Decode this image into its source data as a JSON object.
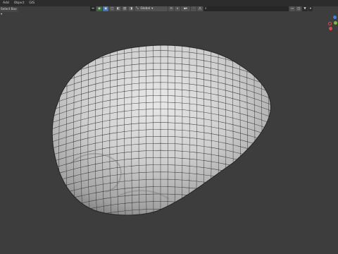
{
  "menu": {
    "items": [
      "Add",
      "Object",
      "GIS"
    ]
  },
  "tool_header": {
    "select_mode": "Select Box ▾"
  },
  "viewport_toolbar": {
    "transform_orientation": "Global",
    "snap_label": "",
    "search_value": ""
  },
  "colors": {
    "viewport_bg": "#3d3d3d",
    "header_bg": "#2c2c2c",
    "active_blue": "#4772b3",
    "mesh_fill": "#c9c9c9",
    "wire": "#2a2a2a",
    "gizmo_x": "#e04848",
    "gizmo_y": "#7ab83e",
    "gizmo_z": "#3f7fdc"
  },
  "icons": [
    "cursor-icon",
    "globe-icon",
    "select-icon",
    "pivot-icon",
    "magnet-icon",
    "proportional-icon",
    "funnel-icon",
    "search-icon"
  ]
}
